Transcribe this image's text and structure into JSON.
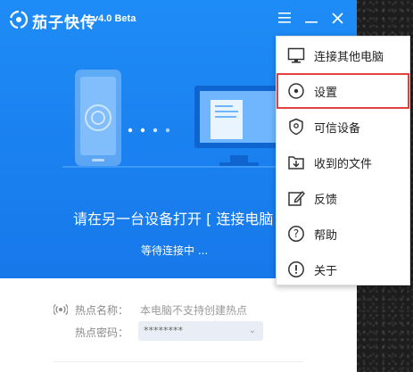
{
  "app": {
    "name": "茄子快传",
    "version": "v4.0 Beta"
  },
  "hero": {
    "connect_title": "请在另一台设备打开 [ 连接电脑",
    "waiting": "等待连接中 ..."
  },
  "form": {
    "hotspot_name_label": "热点名称：",
    "hotspot_name_value": "本电脑不支持创建热点",
    "hotspot_password_label": "热点密码：",
    "hotspot_password_value": "********"
  },
  "menu": {
    "items": [
      {
        "label": "连接其他电脑",
        "icon": "monitor-icon"
      },
      {
        "label": "设置",
        "icon": "settings-icon"
      },
      {
        "label": "可信设备",
        "icon": "shield-icon"
      },
      {
        "label": "收到的文件",
        "icon": "download-folder-icon"
      },
      {
        "label": "反馈",
        "icon": "edit-icon"
      },
      {
        "label": "帮助",
        "icon": "help-icon"
      },
      {
        "label": "关于",
        "icon": "info-icon"
      }
    ],
    "highlighted_index": 1
  },
  "colors": {
    "brand_blue": "#1e8cf6",
    "highlight_red": "#e0433d"
  }
}
